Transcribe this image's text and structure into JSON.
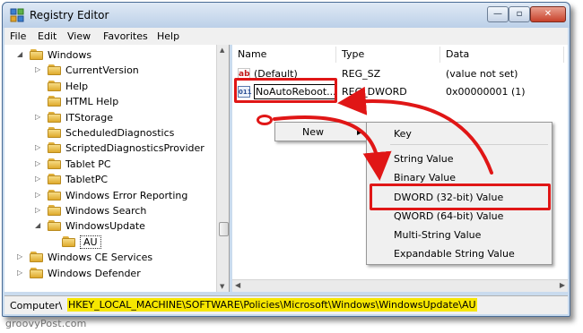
{
  "window": {
    "title": "Registry Editor"
  },
  "title_buttons": {
    "minimize": "—",
    "maximize": "▫",
    "close": "✕"
  },
  "menu": [
    "File",
    "Edit",
    "View",
    "Favorites",
    "Help"
  ],
  "tree": [
    {
      "label": "Windows",
      "level": 1,
      "expander": "expanded"
    },
    {
      "label": "CurrentVersion",
      "level": 2,
      "expander": "collapsed"
    },
    {
      "label": "Help",
      "level": 2,
      "expander": "none"
    },
    {
      "label": "HTML Help",
      "level": 2,
      "expander": "none"
    },
    {
      "label": "ITStorage",
      "level": 2,
      "expander": "collapsed"
    },
    {
      "label": "ScheduledDiagnostics",
      "level": 2,
      "expander": "none"
    },
    {
      "label": "ScriptedDiagnosticsProvider",
      "level": 2,
      "expander": "collapsed"
    },
    {
      "label": "Tablet PC",
      "level": 2,
      "expander": "collapsed"
    },
    {
      "label": "TabletPC",
      "level": 2,
      "expander": "collapsed"
    },
    {
      "label": "Windows Error Reporting",
      "level": 2,
      "expander": "collapsed"
    },
    {
      "label": "Windows Search",
      "level": 2,
      "expander": "collapsed"
    },
    {
      "label": "WindowsUpdate",
      "level": 2,
      "expander": "expanded"
    },
    {
      "label": "AU",
      "level": 3,
      "expander": "none",
      "selected": true
    },
    {
      "label": "Windows CE Services",
      "level": 1,
      "expander": "collapsed"
    },
    {
      "label": "Windows Defender",
      "level": 1,
      "expander": "collapsed"
    }
  ],
  "columns": {
    "name": "Name",
    "type": "Type",
    "data": "Data"
  },
  "values": [
    {
      "icon": "string-value-icon",
      "icon_text": "ab",
      "name": "(Default)",
      "type": "REG_SZ",
      "data": "(value not set)",
      "editing": false
    },
    {
      "icon": "dword-value-icon",
      "icon_text": "011",
      "name": "NoAutoReboot...",
      "type": "REG_DWORD",
      "data": "0x00000001 (1)",
      "editing": true
    }
  ],
  "context_menu": {
    "new_label": "New"
  },
  "submenu": [
    "Key",
    "String Value",
    "Binary Value",
    "DWORD (32-bit) Value",
    "QWORD (64-bit) Value",
    "Multi-String Value",
    "Expandable String Value"
  ],
  "status": {
    "prefix": "Computer\\",
    "path": "HKEY_LOCAL_MACHINE\\SOFTWARE\\Policies\\Microsoft\\Windows\\WindowsUpdate\\AU"
  },
  "watermark": "groovyPost.com",
  "colors": {
    "annotation_red": "#e01616",
    "highlight_yellow": "#f6e600"
  }
}
